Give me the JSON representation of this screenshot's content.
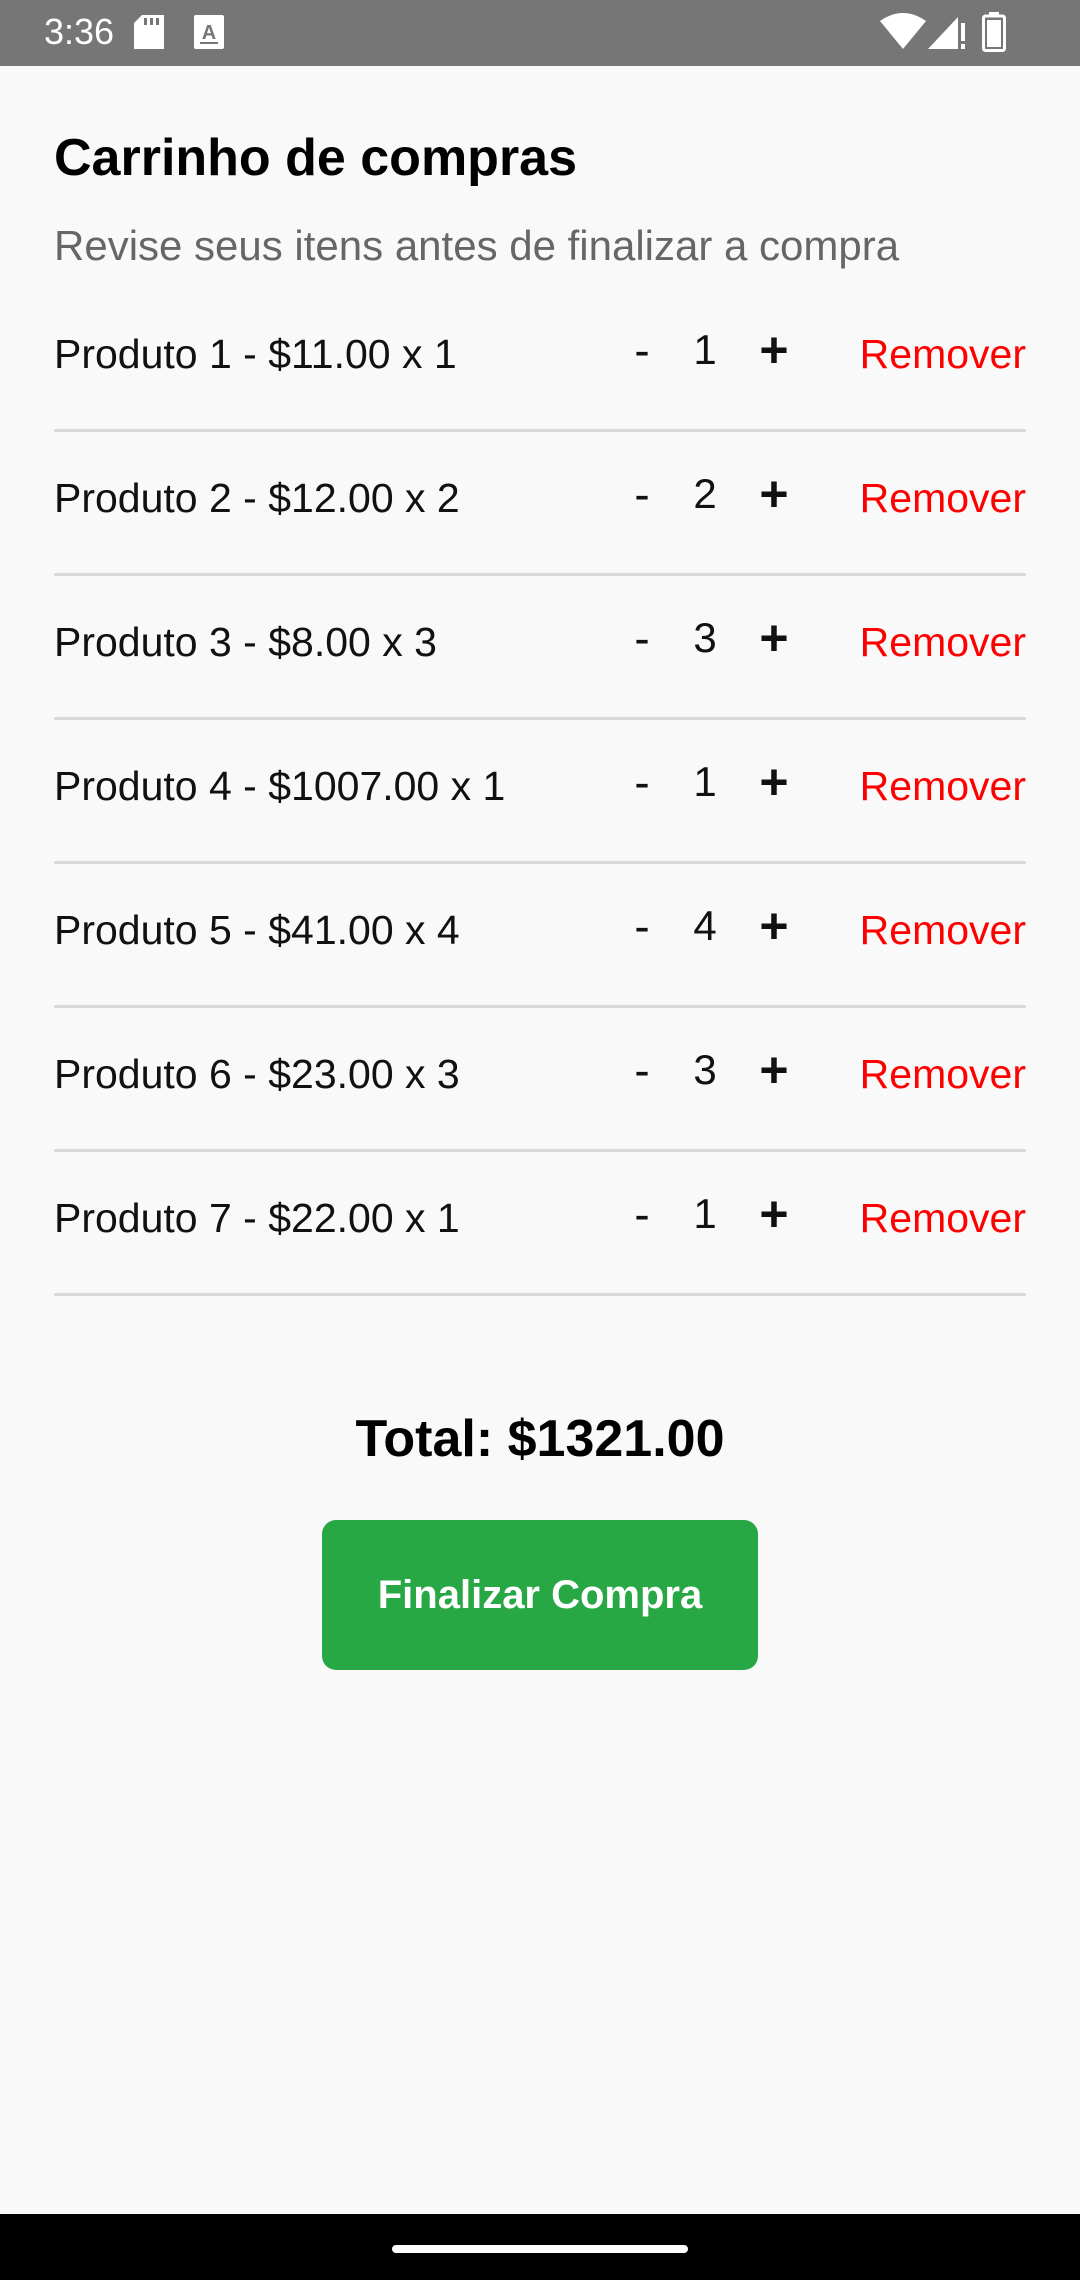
{
  "status_bar": {
    "time": "3:36",
    "icons": [
      "sd-card-icon",
      "keyboard-a-icon",
      "wifi-icon",
      "signal-icon",
      "battery-icon"
    ]
  },
  "header": {
    "title": "Carrinho de compras",
    "subtitle": "Revise seus itens antes de finalizar a compra"
  },
  "cart": {
    "items": [
      {
        "label": "Produto 1 - $11.00 x 1",
        "minus": "-",
        "qty": "1",
        "plus": "+",
        "remove": "Remover"
      },
      {
        "label": "Produto 2 - $12.00 x 2",
        "minus": "-",
        "qty": "2",
        "plus": "+",
        "remove": "Remover"
      },
      {
        "label": "Produto 3 - $8.00 x 3",
        "minus": "-",
        "qty": "3",
        "plus": "+",
        "remove": "Remover"
      },
      {
        "label": "Produto 4 - $1007.00 x 1",
        "minus": "-",
        "qty": "1",
        "plus": "+",
        "remove": "Remover"
      },
      {
        "label": "Produto 5 - $41.00 x 4",
        "minus": "-",
        "qty": "4",
        "plus": "+",
        "remove": "Remover"
      },
      {
        "label": "Produto 6 - $23.00 x 3",
        "minus": "-",
        "qty": "3",
        "plus": "+",
        "remove": "Remover"
      },
      {
        "label": "Produto 7 - $22.00 x 1",
        "minus": "-",
        "qty": "1",
        "plus": "+",
        "remove": "Remover"
      }
    ]
  },
  "summary": {
    "total": "Total: $1321.00",
    "checkout_label": "Finalizar Compra"
  },
  "colors": {
    "status_bar": "#767676",
    "background": "#f9f9f9",
    "remove": "#ff0000",
    "checkout": "#28a745",
    "divider": "#d9d9d9"
  }
}
